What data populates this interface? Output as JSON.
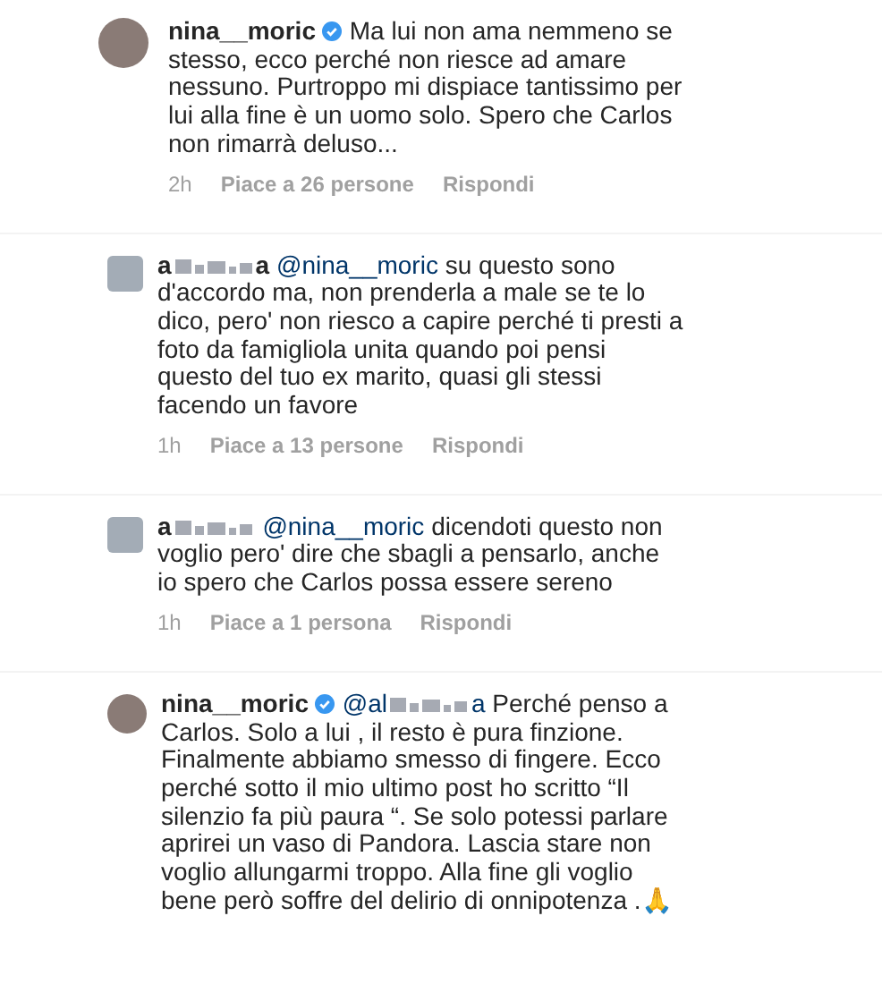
{
  "comment": {
    "author": {
      "kind": "named",
      "name": "nina__moric"
    },
    "verified": true,
    "text": "Ma lui non ama nemmeno se stesso, ecco perché non riesce ad amare nessuno. Purtroppo mi dispiace tantissimo per lui alla fine è un uomo solo. Spero che Carlos non rimarrà deluso...",
    "time": "2h",
    "likes": "Piace a 26 persone",
    "reply": "Rispondi",
    "replies": [
      {
        "author": {
          "kind": "redacted",
          "start": "a",
          "end": "a"
        },
        "verified": false,
        "mention": {
          "kind": "named",
          "name": "@nina__moric"
        },
        "text": "su questo sono d'accordo ma, non prenderla a male se te lo dico, pero' non riesco a capire perché ti presti a foto da famigliola unita quando poi pensi questo del tuo ex marito, quasi gli stessi facendo un favore",
        "time": "1h",
        "likes": "Piace a 13 persone",
        "reply": "Rispondi"
      },
      {
        "author": {
          "kind": "redacted",
          "start": "a"
        },
        "verified": false,
        "mention": {
          "kind": "named",
          "name": "@nina__moric"
        },
        "text": "dicendoti questo non voglio pero' dire che sbagli a pensarlo, anche io spero che Carlos possa essere sereno",
        "time": "1h",
        "likes": "Piace a 1 persona",
        "reply": "Rispondi"
      },
      {
        "author": {
          "kind": "named",
          "name": "nina__moric"
        },
        "verified": true,
        "mention": {
          "kind": "redacted",
          "start": "@al",
          "end": "a"
        },
        "text": "Perché penso a Carlos. Solo a lui , il resto è pura finzione. Finalmente abbiamo smesso di fingere. Ecco perché sotto il mio ultimo post ho scritto “Il silenzio fa più paura “. Se solo potessi parlare aprirei un vaso di Pandora. Lascia stare non voglio allungarmi troppo. Alla fine gli voglio bene però soffre del delirio di onnipotenza .🙏"
      }
    ]
  }
}
